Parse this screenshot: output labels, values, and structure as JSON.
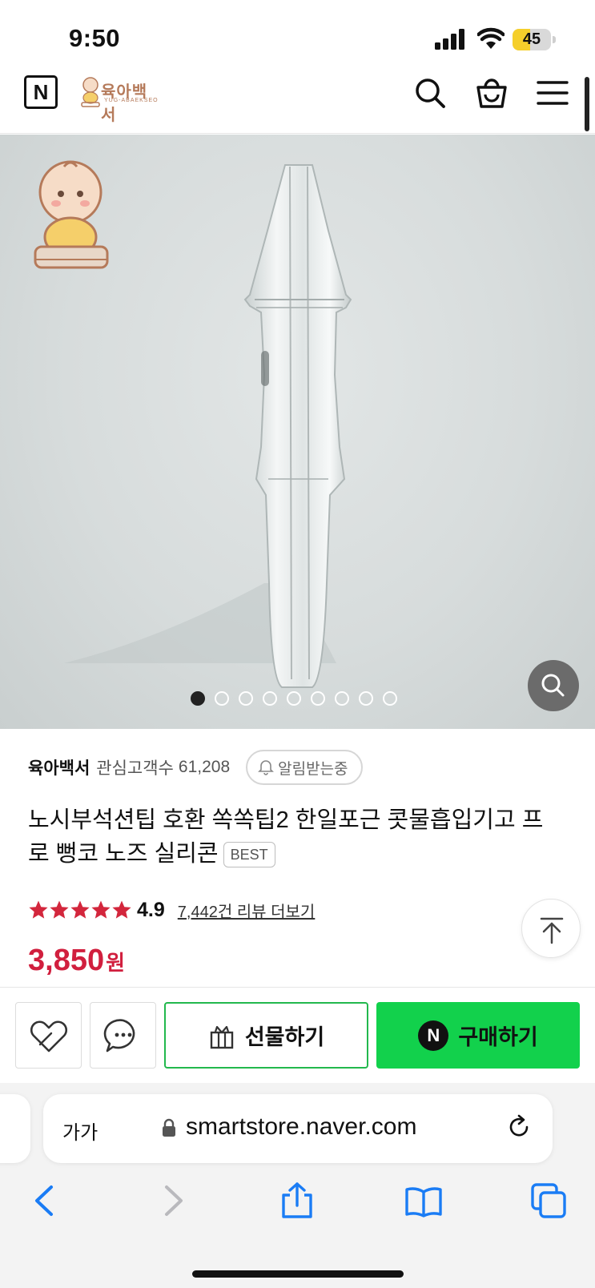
{
  "status_bar": {
    "time": "9:50",
    "battery": "45",
    "battery_level_percent": 45
  },
  "header": {
    "naver_logo": "N",
    "store_logo_text": "육아백서",
    "store_logo_sub": "YUG-ABAEKSEO"
  },
  "icons": {
    "signal": "signal-icon",
    "wifi": "wifi-icon",
    "search": "search-icon",
    "cart": "shopping-bag-icon",
    "menu": "hamburger-menu-icon",
    "zoom": "magnifier-icon",
    "bell": "bell-icon",
    "star": "star-icon",
    "scroll_top": "arrow-up-icon",
    "like": "heart-icon",
    "chat": "chat-bubble-icon",
    "gift": "gift-icon",
    "lock": "lock-icon",
    "reload": "reload-icon",
    "back": "back-icon",
    "forward": "forward-icon",
    "share": "share-icon",
    "bookmarks": "book-icon",
    "tabs": "tabs-icon"
  },
  "gallery": {
    "total_images": 9,
    "active_index": 0
  },
  "product": {
    "seller": "육아백서",
    "interest_label": "관심고객수",
    "interest_count": "61,208",
    "alert_label": "알림받는중",
    "title": "노시부석션팁 호환 쏙쏙팁2 한일포근 콧물흡입기고 프로 뻥코 노즈 실리콘",
    "badge": "BEST",
    "rating": "4.9",
    "stars": 5,
    "review_link": "7,442건 리뷰 더보기",
    "price": "3,850",
    "price_unit": "원"
  },
  "actions": {
    "gift_label": "선물하기",
    "buy_label": "구매하기",
    "buy_n": "N"
  },
  "browser": {
    "aa_label": "가가",
    "url": "smartstore.naver.com"
  },
  "colors": {
    "price": "#d11f3e",
    "buy_green": "#12d14c",
    "gift_border": "#22b84d",
    "star": "#d3263c"
  }
}
